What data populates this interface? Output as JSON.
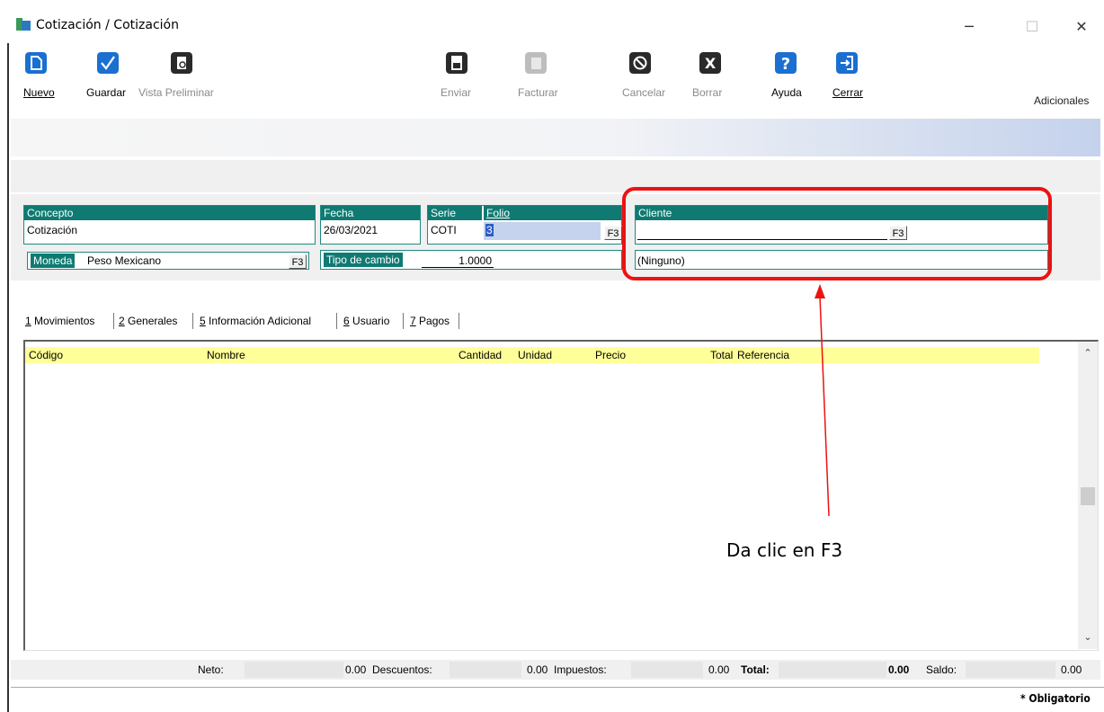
{
  "window": {
    "title": "Cotización / Cotización",
    "controls": {
      "minimize": "─",
      "maximize": "☐",
      "close": "✕"
    }
  },
  "toolbar": {
    "items": [
      {
        "label": "Nuevo",
        "icon": "new-document-icon",
        "enabled": true
      },
      {
        "label": "Guardar",
        "icon": "checkmark-save-icon",
        "enabled": true
      },
      {
        "label": "Vista Preliminar",
        "icon": "print-preview-icon",
        "enabled": false
      },
      {
        "label": "Enviar",
        "icon": "send-document-icon",
        "enabled": false
      },
      {
        "label": "Facturar",
        "icon": "invoice-icon",
        "enabled": false
      },
      {
        "label": "Cancelar",
        "icon": "cancel-icon",
        "enabled": false
      },
      {
        "label": "Borrar",
        "icon": "delete-x-icon",
        "enabled": false
      },
      {
        "label": "Ayuda",
        "icon": "help-icon",
        "enabled": true
      },
      {
        "label": "Cerrar",
        "icon": "exit-door-icon",
        "enabled": true
      }
    ],
    "adicionales": "Adicionales"
  },
  "header": {
    "concepto": {
      "label": "Concepto",
      "value": "Cotización"
    },
    "fecha": {
      "label": "Fecha",
      "value": "26/03/2021"
    },
    "serie": {
      "label": "Serie",
      "value": "COTI"
    },
    "folio": {
      "label": "Folio",
      "value": "3"
    },
    "cliente": {
      "label": "Cliente",
      "value": "",
      "name": "(Ninguno)"
    },
    "moneda": {
      "label": "Moneda",
      "value": "Peso Mexicano"
    },
    "tipo_cambio": {
      "label": "Tipo de cambio",
      "value": "1.0000"
    },
    "f3": "F3"
  },
  "tabs": [
    {
      "key": "1",
      "label": "Movimientos"
    },
    {
      "key": "2",
      "label": "Generales"
    },
    {
      "key": "5",
      "label": "Información Adicional"
    },
    {
      "key": "6",
      "label": "Usuario"
    },
    {
      "key": "7",
      "label": "Pagos"
    }
  ],
  "grid": {
    "columns": [
      "Código",
      "Nombre",
      "Cantidad",
      "Unidad",
      "Precio",
      "Total",
      "Referencia"
    ],
    "rows": []
  },
  "totals": {
    "neto": {
      "label": "Neto:",
      "value": "0.00"
    },
    "descuentos": {
      "label": "Descuentos:",
      "value": "0.00"
    },
    "impuestos": {
      "label": "Impuestos:",
      "value": "0.00"
    },
    "total": {
      "label": "Total:",
      "value": "0.00"
    },
    "saldo": {
      "label": "Saldo:",
      "value": "0.00"
    }
  },
  "footer": {
    "obligatorio": "* Obligatorio"
  },
  "annotation": {
    "text": "Da clic en F3",
    "color": "#ee1111"
  },
  "colors": {
    "field_header": "#0f7a72",
    "grid_header": "#ffff99",
    "toolbar_blue": "#1a6fd1"
  }
}
